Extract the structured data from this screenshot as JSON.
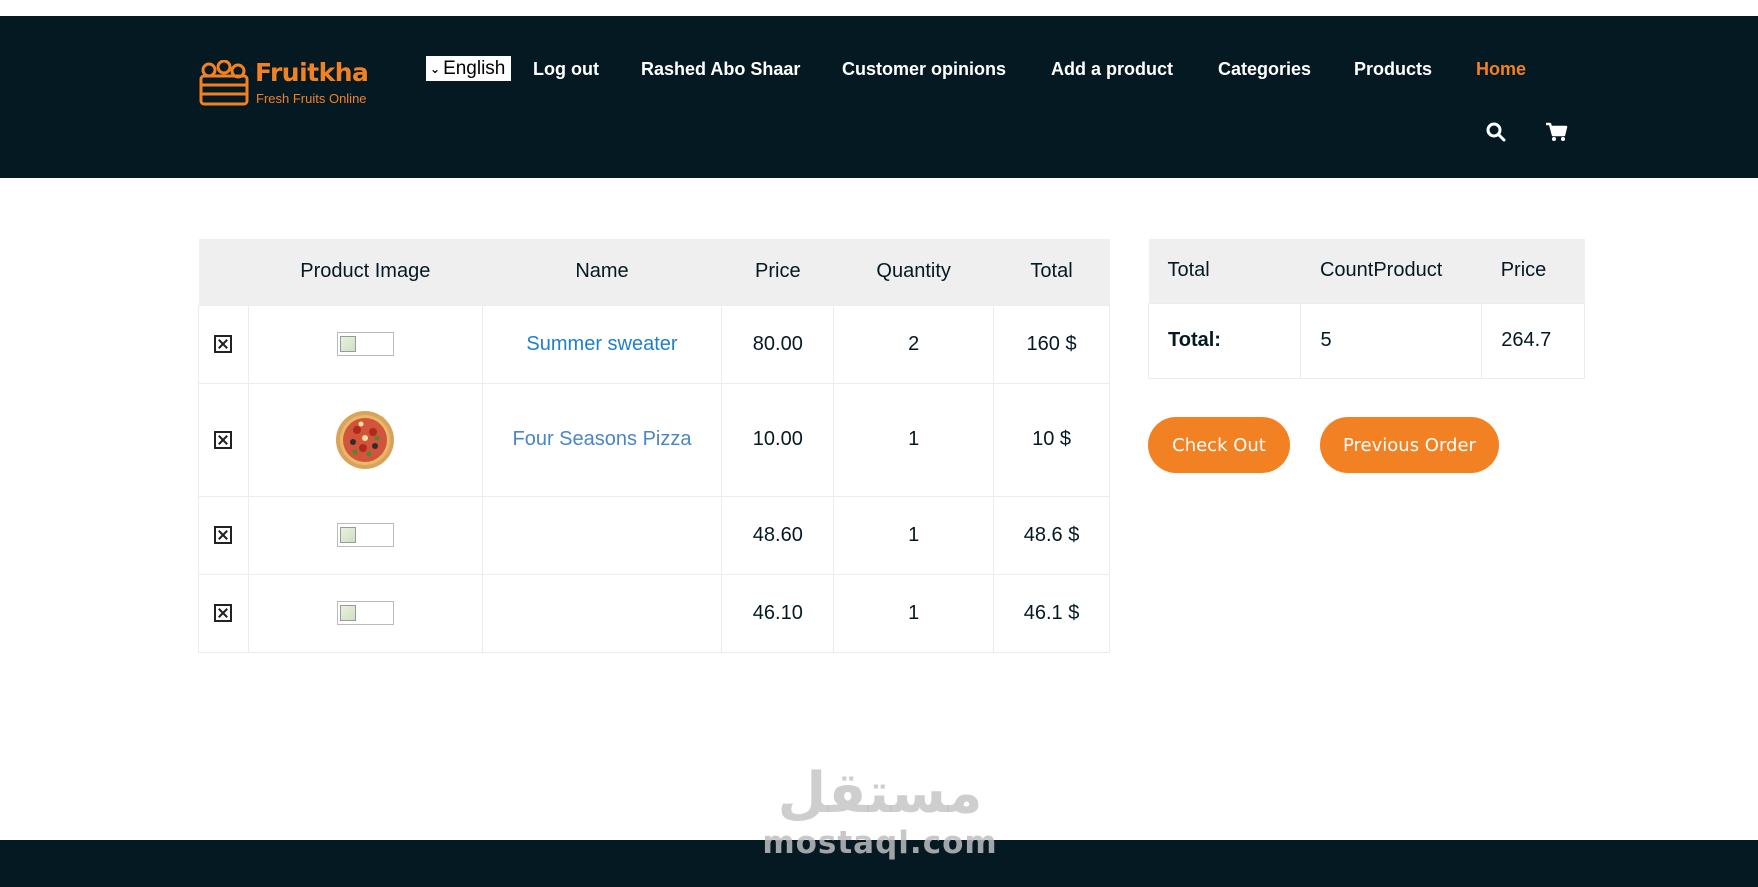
{
  "brand": {
    "name": "Fruitkha",
    "tagline": "Fresh Fruits Online",
    "accent_color": "#F28123",
    "dark_color": "#051922",
    "logo_icon": "fruit-crate-icon"
  },
  "header": {
    "language": "English",
    "nav": {
      "logout": "Log out",
      "user": "Rashed Abo Shaar",
      "opinions": "Customer opinions",
      "add_product": "Add a product",
      "categories": "Categories",
      "products": "Products",
      "home": "Home"
    },
    "icons": [
      "search-icon",
      "cart-icon"
    ]
  },
  "cart": {
    "headers": {
      "remove": "",
      "image": "Product Image",
      "name": "Name",
      "price": "Price",
      "quantity": "Quantity",
      "total": "Total"
    },
    "rows": [
      {
        "name": "Summer sweater",
        "price": "80.00",
        "quantity": "2",
        "total": "160 $",
        "image": "broken-image"
      },
      {
        "name": "Four Seasons Pizza",
        "price": "10.00",
        "quantity": "1",
        "total": "10 $",
        "image": "pizza-image"
      },
      {
        "name": "",
        "price": "48.60",
        "quantity": "1",
        "total": "48.6 $",
        "image": "broken-image"
      },
      {
        "name": "",
        "price": "46.10",
        "quantity": "1",
        "total": "46.1 $",
        "image": "broken-image"
      }
    ]
  },
  "summary": {
    "headers": {
      "total": "Total",
      "count": "CountProduct",
      "price": "Price"
    },
    "row": {
      "label": "Total:",
      "count": "5",
      "price": "264.7"
    }
  },
  "actions": {
    "checkout": "Check Out",
    "previous": "Previous Order"
  },
  "watermark": {
    "arabic": "مستقل",
    "latin": "mostaql.com"
  }
}
